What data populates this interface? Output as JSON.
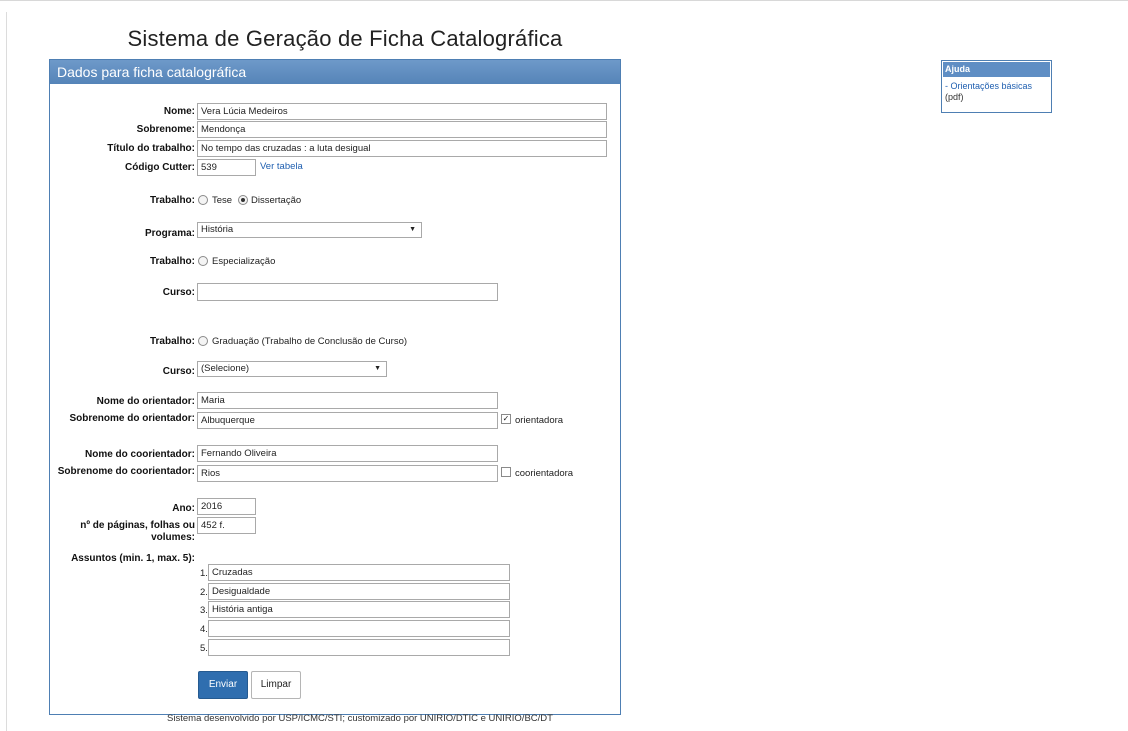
{
  "page_title": "Sistema de Geração de Ficha Catalográfica",
  "panel_title": "Dados para ficha catalográfica",
  "fields": {
    "nome": {
      "label": "Nome:",
      "value": "Vera Lúcia Medeiros"
    },
    "sobrenome": {
      "label": "Sobrenome:",
      "value": "Mendonça"
    },
    "titulo": {
      "label": "Título do trabalho:",
      "value": "No tempo das cruzadas : a luta desigual"
    },
    "cutter": {
      "label": "Código Cutter:",
      "value": "539",
      "link": "Ver tabela"
    }
  },
  "trabalho_pos": {
    "label": "Trabalho:",
    "options": [
      {
        "label": "Tese",
        "checked": false
      },
      {
        "label": "Dissertação",
        "checked": true
      }
    ]
  },
  "programa": {
    "label": "Programa:",
    "selected": "História"
  },
  "trabalho_esp": {
    "label": "Trabalho:",
    "option": "Especialização",
    "checked": false
  },
  "curso_esp": {
    "label": "Curso:",
    "value": ""
  },
  "trabalho_grad": {
    "label": "Trabalho:",
    "option": "Graduação (Trabalho de Conclusão de Curso)",
    "checked": false
  },
  "curso_grad": {
    "label": "Curso:",
    "selected": "(Selecione)"
  },
  "orientador": {
    "nome_label": "Nome do orientador:",
    "nome": "Maria",
    "sobrenome_label": "Sobrenome do orientador:",
    "sobrenome": "Albuquerque",
    "checkbox_label": "orientadora",
    "checked": true
  },
  "coorientador": {
    "nome_label": "Nome do coorientador:",
    "nome": "Fernando Oliveira",
    "sobrenome_label": "Sobrenome do coorientador:",
    "sobrenome": "Rios",
    "checkbox_label": "coorientadora",
    "checked": false
  },
  "ano": {
    "label": "Ano:",
    "value": "2016"
  },
  "paginas": {
    "label": "nº de páginas, folhas ou volumes:",
    "value": "452 f."
  },
  "assuntos": {
    "label": "Assuntos (min. 1, max. 5):",
    "items": [
      {
        "num": "1.",
        "value": "Cruzadas"
      },
      {
        "num": "2.",
        "value": "Desigualdade"
      },
      {
        "num": "3.",
        "value": "História antiga"
      },
      {
        "num": "4.",
        "value": ""
      },
      {
        "num": "5.",
        "value": ""
      }
    ]
  },
  "buttons": {
    "submit": "Enviar",
    "clear": "Limpar"
  },
  "footer": "Sistema desenvolvido por USP/ICMC/STI; customizado por UNIRIO/DTIC e UNIRIO/BC/DT",
  "help": {
    "title": "Ajuda",
    "link": "- Orientações básicas",
    "link_suffix": "(pdf)"
  },
  "colors": {
    "panel_header": "#5f8ec4",
    "primary_button": "#2f6eaf",
    "link": "#1f5fb0"
  }
}
